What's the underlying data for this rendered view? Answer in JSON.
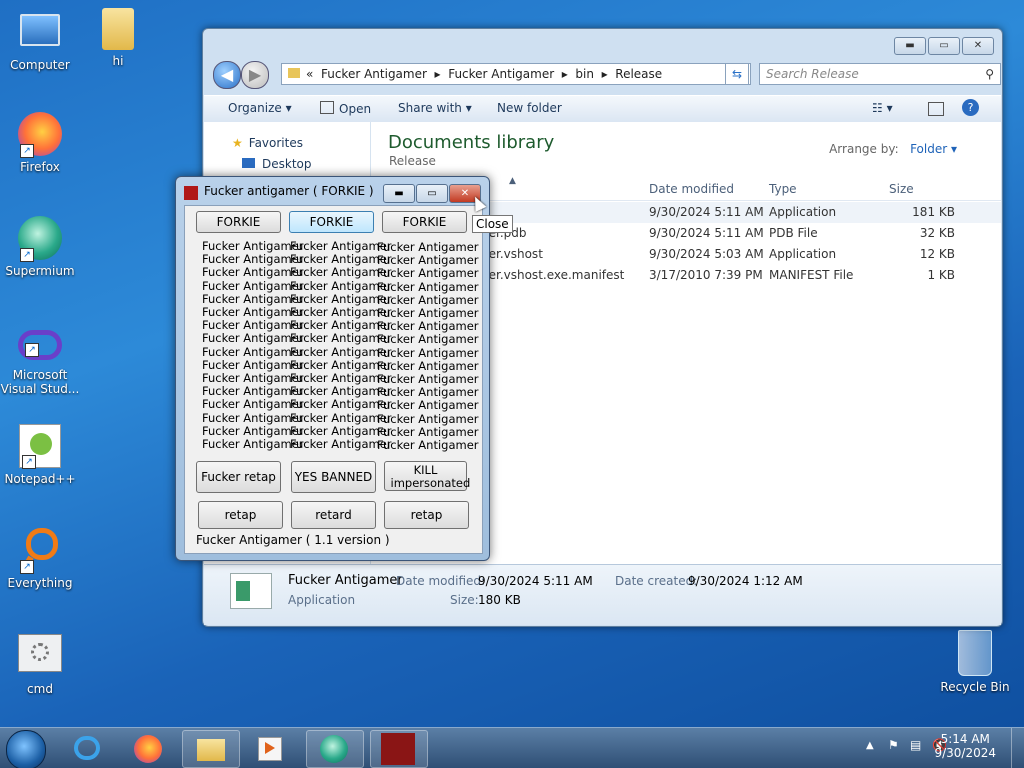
{
  "desktop": {
    "icons": [
      {
        "label": "Computer"
      },
      {
        "label": "hi"
      },
      {
        "label": "Firefox"
      },
      {
        "label": "Supermium"
      },
      {
        "label": "Microsoft Visual Stud..."
      },
      {
        "label": "Notepad++"
      },
      {
        "label": "Everything"
      },
      {
        "label": "cmd"
      },
      {
        "label": "Recycle Bin"
      }
    ]
  },
  "explorer": {
    "breadcrumb": [
      "«",
      "Fucker Antigamer",
      "Fucker Antigamer",
      "bin",
      "Release"
    ],
    "search_placeholder": "Search Release",
    "toolbar": {
      "organize": "Organize ▾",
      "open": "Open",
      "share": "Share with ▾",
      "new_folder": "New folder"
    },
    "nav": {
      "favorites": "Favorites",
      "desktop": "Desktop"
    },
    "library_title": "Documents library",
    "library_sub": "Release",
    "arrange_label": "Arrange by:",
    "arrange_value": "Folder ▾",
    "columns": {
      "date": "Date modified",
      "type": "Type",
      "size": "Size"
    },
    "files": [
      {
        "name": "",
        "date": "9/30/2024 5:11 AM",
        "type": "Application",
        "size": "181 KB"
      },
      {
        "name": "ner.pdb",
        "date": "9/30/2024 5:11 AM",
        "type": "PDB File",
        "size": "32 KB"
      },
      {
        "name": "ner.vshost",
        "date": "9/30/2024 5:03 AM",
        "type": "Application",
        "size": "12 KB"
      },
      {
        "name": "ner.vshost.exe.manifest",
        "date": "3/17/2010 7:39 PM",
        "type": "MANIFEST File",
        "size": "1 KB"
      }
    ],
    "details": {
      "name": "Fucker Antigamer",
      "kind": "Application",
      "date_modified_label": "Date modified:",
      "date_modified": "9/30/2024 5:11 AM",
      "date_created_label": "Date created:",
      "date_created": "9/30/2024 1:12 AM",
      "size_label": "Size:",
      "size": "180 KB"
    }
  },
  "app": {
    "title": "Fucker antigamer ( FORKIE )",
    "top_buttons": [
      "FORKIE",
      "FORKIE",
      "FORKIE"
    ],
    "label_text": "Fucker Antigamer",
    "label_rows": 16,
    "big_buttons": [
      "Fucker retap",
      "YES BANNED",
      "KILL impersonated"
    ],
    "small_buttons": [
      "retap",
      "retard",
      "retap"
    ],
    "version": "Fucker Antigamer ( 1.1 version )"
  },
  "tooltip": "Close",
  "taskbar": {
    "time": "5:14 AM",
    "date": "9/30/2024"
  }
}
